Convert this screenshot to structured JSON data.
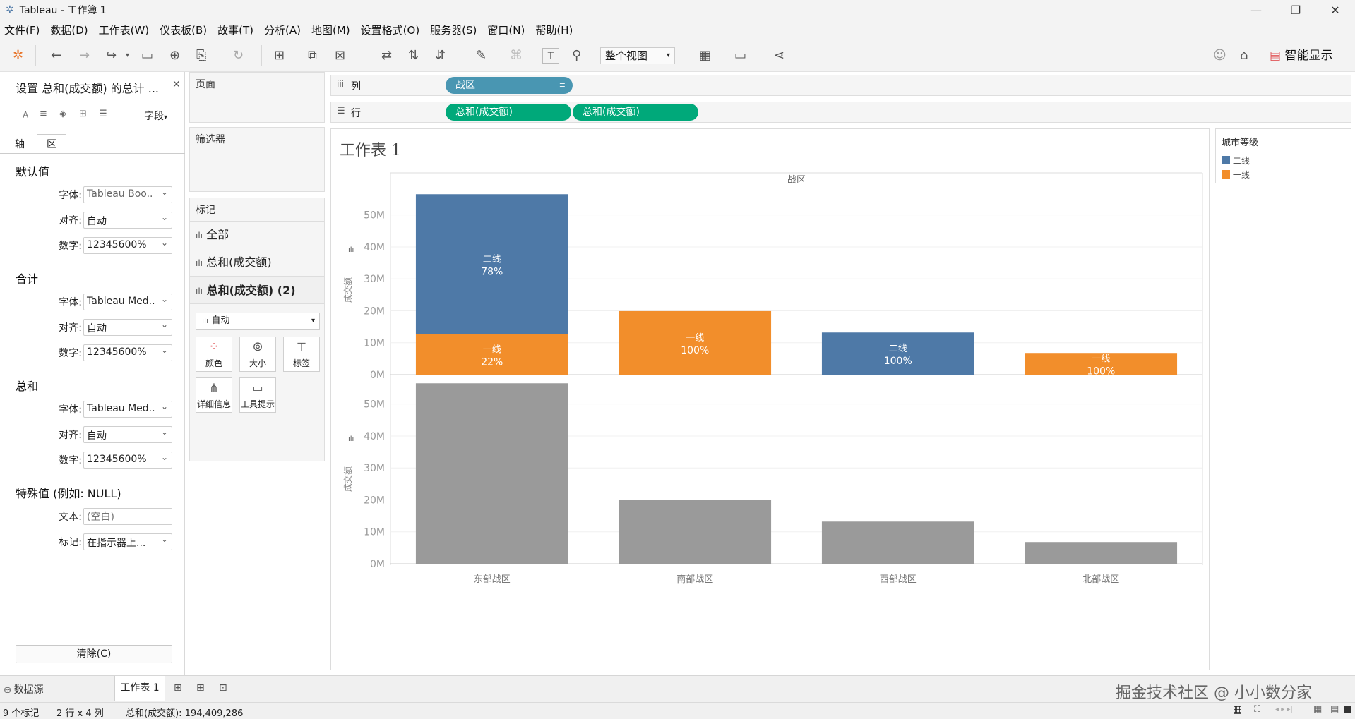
{
  "window": {
    "title": "Tableau - 工作簿 1"
  },
  "menu": [
    "文件(F)",
    "数据(D)",
    "工作表(W)",
    "仪表板(B)",
    "故事(T)",
    "分析(A)",
    "地图(M)",
    "设置格式(O)",
    "服务器(S)",
    "窗口(N)",
    "帮助(H)"
  ],
  "toolbar": {
    "fit_label": "整个视图",
    "show_me_label": "智能显示"
  },
  "format_pane": {
    "title": "设置 总和(成交额) 的总计 ...",
    "fields_label": "字段",
    "tabs": [
      "轴",
      "区"
    ],
    "default": {
      "title": "默认值",
      "font_label": "字体:",
      "font": "Tableau Boo..",
      "align_label": "对齐:",
      "align": "自动",
      "number_label": "数字:",
      "number": "12345600%"
    },
    "total": {
      "title": "合计",
      "font_label": "字体:",
      "font": "Tableau Med..",
      "align_label": "对齐:",
      "align": "自动",
      "number_label": "数字:",
      "number": "12345600%"
    },
    "sum": {
      "title": "总和",
      "font_label": "字体:",
      "font": "Tableau Med..",
      "align_label": "对齐:",
      "align": "自动",
      "number_label": "数字:",
      "number": "12345600%"
    },
    "special": {
      "title": "特殊值 (例如: NULL)",
      "text_label": "文本:",
      "text_placeholder": "(空白)",
      "mark_label": "标记:",
      "mark": "在指示器上..."
    },
    "clear_label": "清除(C)"
  },
  "cards": {
    "pages": "页面",
    "filters": "筛选器",
    "marks": {
      "title": "标记",
      "items": [
        "全部",
        "总和(成交额)",
        "总和(成交额) (2)"
      ],
      "mark_type": "自动",
      "buttons": [
        "颜色",
        "大小",
        "标签",
        "详细信息",
        "工具提示"
      ]
    }
  },
  "shelves": {
    "columns_label": "列",
    "rows_label": "行",
    "columns_pills": [
      "战区"
    ],
    "rows_pills": [
      "总和(成交额)",
      "总和(成交额)"
    ]
  },
  "sheet": {
    "title": "工作表 1",
    "header": "战区"
  },
  "legend": {
    "title": "城市等级",
    "items": [
      {
        "label": "二线",
        "color": "#4e79a7"
      },
      {
        "label": "一线",
        "color": "#f28e2b"
      }
    ]
  },
  "tabs": {
    "datasource": "数据源",
    "sheet": "工作表 1"
  },
  "status": {
    "marks": "9 个标记",
    "dims": "2 行 x 4 列",
    "sum": "总和(成交额): 194,409,286"
  },
  "watermark": "掘金技术社区 @ 小小数分家",
  "chart_data": {
    "type": "bar",
    "categories": [
      "东部战区",
      "南部战区",
      "西部战区",
      "北部战区"
    ],
    "ylabel": "成交额",
    "yticks": [
      "0M",
      "10M",
      "20M",
      "30M",
      "40M",
      "50M"
    ],
    "ylim": [
      0,
      57000000
    ],
    "top_panel": {
      "stacked": true,
      "series": [
        {
          "name": "一线",
          "color": "#f28e2b",
          "values": [
            12600000,
            19900000,
            0,
            6800000
          ],
          "pct": [
            "22%",
            "100%",
            "",
            "100%"
          ]
        },
        {
          "name": "二线",
          "color": "#4e79a7",
          "values": [
            43900000,
            0,
            13200000,
            0
          ],
          "pct": [
            "78%",
            "",
            "100%",
            ""
          ]
        }
      ]
    },
    "bottom_panel": {
      "color": "#9a9a9a",
      "values": [
        56500000,
        19900000,
        13200000,
        6800000
      ]
    }
  }
}
